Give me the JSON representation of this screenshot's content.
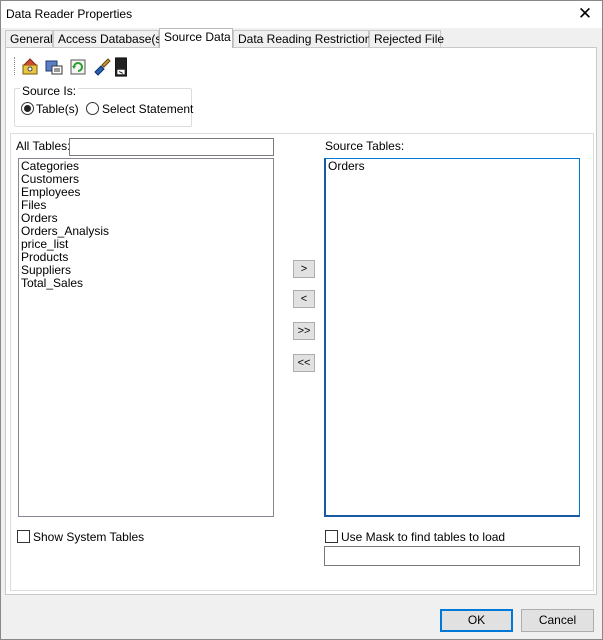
{
  "window": {
    "title": "Data Reader Properties"
  },
  "tabs": [
    {
      "label": "General"
    },
    {
      "label": "Access Database(s)"
    },
    {
      "label": "Source Data"
    },
    {
      "label": "Data Reading Restrictions"
    },
    {
      "label": "Rejected File"
    }
  ],
  "active_tab": "Source Data",
  "toolbar": {
    "icons": [
      "wizard-icon",
      "database-connect-icon",
      "refresh-icon",
      "clean-icon",
      "file-export-icon"
    ]
  },
  "source": {
    "group_label": "Source Is:",
    "option_tables": "Table(s)",
    "option_statement": "Select Statement",
    "selected": "Table(s)"
  },
  "all_tables": {
    "label": "All Tables:",
    "filter_value": "",
    "items": [
      "Categories",
      "Customers",
      "Employees",
      "Files",
      "Orders",
      "Orders_Analysis",
      "price_list",
      "Products",
      "Suppliers",
      "Total_Sales"
    ]
  },
  "source_tables": {
    "label": "Source Tables:",
    "items": [
      "Orders"
    ]
  },
  "move_buttons": {
    "add": ">",
    "remove": "<",
    "add_all": ">>",
    "remove_all": "<<"
  },
  "options": {
    "show_system_tables": "Show System Tables",
    "use_mask": "Use Mask to find tables to load",
    "mask_value": ""
  },
  "footer": {
    "ok": "OK",
    "cancel": "Cancel"
  }
}
